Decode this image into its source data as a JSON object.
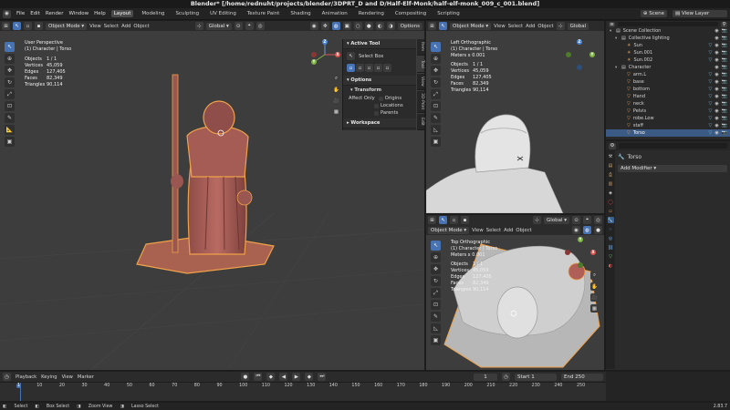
{
  "title": "Blender* [/home/rednuht/projects/blender/3DPRT_D and D/Half-Elf-Monk/half-elf-monk_009_c_001.blend]",
  "menu": [
    "File",
    "Edit",
    "Render",
    "Window",
    "Help"
  ],
  "workspaces": [
    "Layout",
    "Modeling",
    "Sculpting",
    "UV Editing",
    "Texture Paint",
    "Shading",
    "Animation",
    "Rendering",
    "Compositing",
    "Scripting"
  ],
  "scene": {
    "label": "Scene",
    "view_layer": "View Layer"
  },
  "viewport_main": {
    "mode": "Object Mode",
    "menus": [
      "View",
      "Select",
      "Add",
      "Object"
    ],
    "orientation": "Global",
    "options": "Options",
    "view_name": "User Perspective",
    "collection": "(1) Character | Torso",
    "stats": [
      {
        "k": "Objects",
        "v": "1 / 1"
      },
      {
        "k": "Vertices",
        "v": "45,059"
      },
      {
        "k": "Edges",
        "v": "127,405"
      },
      {
        "k": "Faces",
        "v": "82,349"
      },
      {
        "k": "Triangles",
        "v": "90,114"
      }
    ]
  },
  "npanel": {
    "active_tool": "Active Tool",
    "select_box": "Select Box",
    "options": "Options",
    "transform": "Transform",
    "affect_only": "Affect Only",
    "origins": "Origins",
    "locations": "Locations",
    "parents": "Parents",
    "workspace": "Workspace",
    "tabs": [
      "Item",
      "Tool",
      "View",
      "3D-Print",
      "Edit"
    ]
  },
  "viewport_left": {
    "view_name": "Left Orthographic",
    "collection": "(1) Character | Torso",
    "meters": "Meters x 0.001",
    "stats": [
      {
        "k": "Objects",
        "v": "1 / 1"
      },
      {
        "k": "Vertices",
        "v": "45,059"
      },
      {
        "k": "Edges",
        "v": "127,405"
      },
      {
        "k": "Faces",
        "v": "82,349"
      },
      {
        "k": "Triangles",
        "v": "90,114"
      }
    ],
    "mode": "Object Mode",
    "menus": [
      "View",
      "Select",
      "Add",
      "Object"
    ],
    "orientation": "Global"
  },
  "viewport_top": {
    "mode": "Object Mode",
    "menus": [
      "View",
      "Select",
      "Add",
      "Object"
    ],
    "orientation": "Global",
    "view_name": "Top Orthographic",
    "collection": "(1) Character | Torso",
    "meters": "Meters x 0.001",
    "stats": [
      {
        "k": "Objects",
        "v": "1 / 1"
      },
      {
        "k": "Vertices",
        "v": "45,059"
      },
      {
        "k": "Edges",
        "v": "127,405"
      },
      {
        "k": "Faces",
        "v": "82,349"
      },
      {
        "k": "Triangles",
        "v": "90,114"
      }
    ]
  },
  "outliner": {
    "items": [
      {
        "label": "Scene Collection",
        "indent": 0,
        "icon": "collection-icon"
      },
      {
        "label": "Collective lighting",
        "indent": 1,
        "icon": "collection-icon"
      },
      {
        "label": "Sun",
        "indent": 2,
        "icon": "light-icon"
      },
      {
        "label": "Sun.001",
        "indent": 2,
        "icon": "light-icon"
      },
      {
        "label": "Sun.002",
        "indent": 2,
        "icon": "light-icon"
      },
      {
        "label": "Character",
        "indent": 1,
        "icon": "collection-icon"
      },
      {
        "label": "arm.L",
        "indent": 2,
        "icon": "mesh-icon"
      },
      {
        "label": "base",
        "indent": 2,
        "icon": "mesh-icon"
      },
      {
        "label": "bottom",
        "indent": 2,
        "icon": "mesh-icon"
      },
      {
        "label": "Hand",
        "indent": 2,
        "icon": "mesh-icon"
      },
      {
        "label": "neck",
        "indent": 2,
        "icon": "mesh-icon"
      },
      {
        "label": "Pelvis",
        "indent": 2,
        "icon": "mesh-icon"
      },
      {
        "label": "robe.Low",
        "indent": 2,
        "icon": "mesh-icon"
      },
      {
        "label": "staff",
        "indent": 2,
        "icon": "mesh-icon"
      },
      {
        "label": "Torso",
        "indent": 2,
        "icon": "mesh-icon",
        "selected": true
      }
    ]
  },
  "properties": {
    "object": "Torso",
    "add_modifier": "Add Modifier"
  },
  "timeline": {
    "menus": [
      "Playback",
      "Keying",
      "View",
      "Marker"
    ],
    "current": "1",
    "start_label": "Start",
    "start": "1",
    "end_label": "End",
    "end": "250",
    "ruler": [
      "1",
      "10",
      "20",
      "30",
      "40",
      "50",
      "60",
      "70",
      "80",
      "90",
      "100",
      "110",
      "120",
      "130",
      "140",
      "150",
      "160",
      "170",
      "180",
      "190",
      "200",
      "210",
      "220",
      "230",
      "240",
      "250"
    ]
  },
  "statusbar": {
    "select": "Select",
    "box_select": "Box Select",
    "zoom_view": "Zoom View",
    "lasso_select": "Lasso Select",
    "version": "2.83.7"
  },
  "colors": {
    "accent": "#4772b3",
    "selection_outline": "#f0a24a",
    "mesh": "#b0625c"
  }
}
